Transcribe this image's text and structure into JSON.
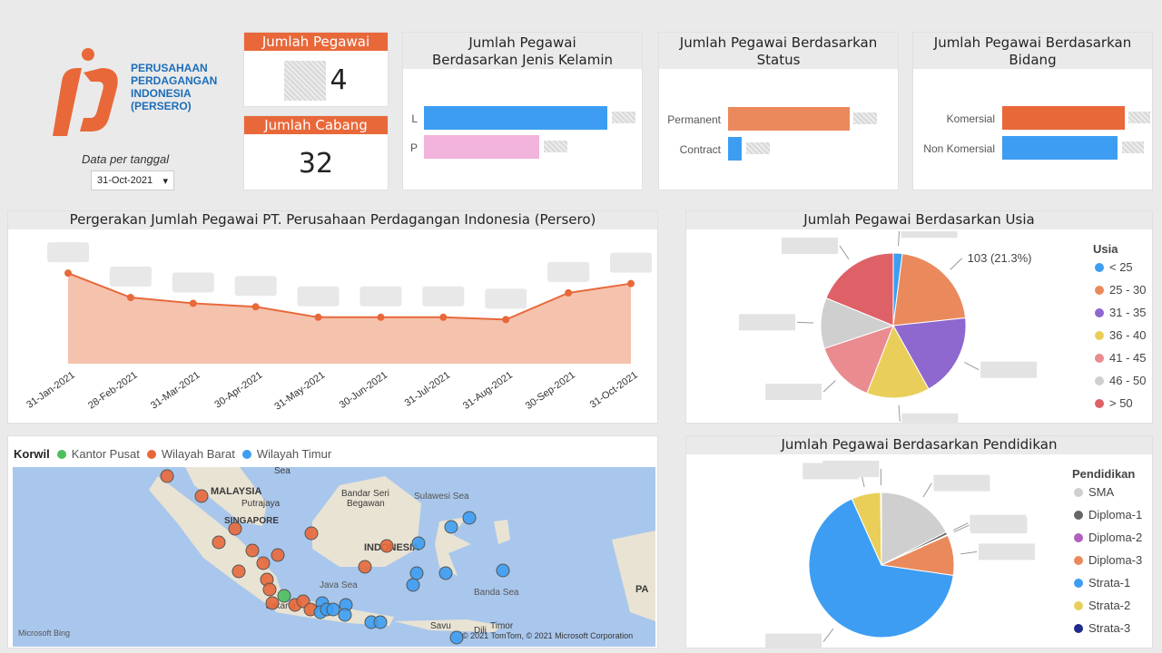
{
  "company": {
    "name_lines": [
      "PERUSAHAAN",
      "PERDAGANGAN",
      "INDONESIA",
      "(PERSERO)"
    ],
    "data_label": "Data per tanggal",
    "date_value": "31-Oct-2021"
  },
  "kpi": {
    "pegawai_title": "Jumlah Pegawai",
    "pegawai_value": "4",
    "cabang_title": "Jumlah Cabang",
    "cabang_value": "32"
  },
  "gender_card": {
    "title": "Jumlah Pegawai Berdasarkan Jenis Kelamin",
    "rows": [
      {
        "label": "L",
        "color": "#3d9df2",
        "share": 0.85
      },
      {
        "label": "P",
        "color": "#f2b3dd",
        "share": 0.52
      }
    ]
  },
  "status_card": {
    "title": "Jumlah Pegawai Berdasarkan Status",
    "rows": [
      {
        "label": "Permanent",
        "color": "#ea8a5c",
        "share": 0.92
      },
      {
        "label": "Contract",
        "color": "#3d9df2",
        "share": 0.1
      }
    ]
  },
  "bidang_card": {
    "title": "Jumlah Pegawai Berdasarkan Bidang",
    "rows": [
      {
        "label": "Komersial",
        "color": "#e8683a",
        "share": 0.93
      },
      {
        "label": "Non Komersial",
        "color": "#3d9df2",
        "share": 0.88
      }
    ]
  },
  "trend": {
    "title": "Pergerakan Jumlah Pegawai PT. Perusahaan Perdagangan Indonesia (Persero)",
    "chart_data": {
      "type": "area",
      "categories": [
        "31-Jan-2021",
        "28-Feb-2021",
        "31-Mar-2021",
        "30-Apr-2021",
        "31-May-2021",
        "30-Jun-2021",
        "31-Jul-2021",
        "31-Aug-2021",
        "30-Sep-2021",
        "31-Oct-2021"
      ],
      "values": [
        0.78,
        0.57,
        0.52,
        0.49,
        0.4,
        0.4,
        0.4,
        0.38,
        0.61,
        0.69
      ],
      "color": "#e8683a",
      "fill": "#f4c2ad"
    }
  },
  "usia": {
    "title": "Jumlah Pegawai Berdasarkan Usia",
    "legend_title": "Usia",
    "label_visible": "103 (21.3%)",
    "chart_data": {
      "type": "pie",
      "labels": [
        "< 25",
        "25 - 30",
        "31 - 35",
        "36 - 40",
        "41 - 45",
        "46 - 50",
        "> 50"
      ],
      "colors": [
        "#3d9df2",
        "#ea8a5c",
        "#8e67cf",
        "#e9cf5a",
        "#ea8b8f",
        "#cfcfcf",
        "#de6168"
      ],
      "values": [
        2.0,
        21.3,
        18.6,
        14.0,
        14.0,
        11.3,
        18.8
      ]
    }
  },
  "pendidikan": {
    "title": "Jumlah Pegawai Berdasarkan Pendidikan",
    "legend_title": "Pendidikan",
    "chart_data": {
      "type": "pie",
      "labels": [
        "SMA",
        "Diploma-1",
        "Diploma-2",
        "Diploma-3",
        "Strata-1",
        "Strata-2",
        "Strata-3"
      ],
      "colors": [
        "#cfcfcf",
        "#666666",
        "#b05fbf",
        "#ea8a5c",
        "#3d9df2",
        "#e9cf5a",
        "#1f2a8c"
      ],
      "values": [
        17.5,
        0.6,
        0.2,
        9.0,
        66.0,
        6.5,
        0.2
      ]
    }
  },
  "map": {
    "legend_title": "Korwil",
    "legend": [
      {
        "label": "Kantor Pusat",
        "color": "#4cbf5c"
      },
      {
        "label": "Wilayah Barat",
        "color": "#e8683a"
      },
      {
        "label": "Wilayah Timur",
        "color": "#3d9df2"
      }
    ],
    "places": [
      "MALAYSIA",
      "Putrajaya",
      "SINGAPORE",
      "INDONESIA",
      "Bandar Seri Begawan",
      "Sulawesi Sea",
      "Java Sea",
      "Banda Sea",
      "Savu",
      "Dili",
      "Timor",
      "Jakarta",
      "Sea",
      "PA"
    ],
    "attribution": "© 2021 TomTom, © 2021 Microsoft Corporation",
    "bing": "Microsoft Bing"
  }
}
